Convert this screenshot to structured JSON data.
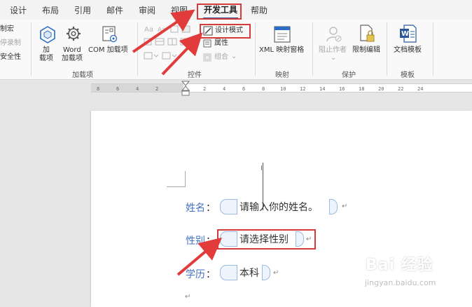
{
  "tabs": [
    {
      "label": "设计"
    },
    {
      "label": "布局"
    },
    {
      "label": "引用"
    },
    {
      "label": "邮件"
    },
    {
      "label": "审阅"
    },
    {
      "label": "视图"
    },
    {
      "label": "开发工具",
      "active": true
    },
    {
      "label": "帮助"
    }
  ],
  "ribbon": {
    "code": {
      "record_macro": "制宏",
      "pause_recording": "停录制",
      "macro_security": "安全性"
    },
    "addins": {
      "addin_line1": "加",
      "addin_line2": "载项",
      "word_addin_line1": "Word",
      "word_addin_line2": "加载项",
      "com_addin": "COM 加载项",
      "group_label": "加载项"
    },
    "controls": {
      "design_mode": "设计模式",
      "properties": "属性",
      "group_dropdown": "组合",
      "group_label": "控件"
    },
    "mapping": {
      "xml_pane": "XML 映射窗格",
      "group_label": "映射"
    },
    "protect": {
      "block_authors": "阻止作者",
      "restrict_editing": "限制编辑",
      "group_label": "保护"
    },
    "templates": {
      "doc_template": "文档模板",
      "group_label": "模板"
    }
  },
  "ruler": {
    "ticks": [
      "8",
      "6",
      "4",
      "2",
      "",
      "2",
      "4",
      "6",
      "8",
      "10",
      "12",
      "14",
      "16",
      "18",
      "20",
      "22",
      "24"
    ]
  },
  "document": {
    "fields": [
      {
        "label": "姓名",
        "colon": "：",
        "content": "请输入你的姓名。"
      },
      {
        "label": "性别",
        "colon": "：",
        "content": "请选择性别"
      },
      {
        "label": "学历",
        "colon": "：",
        "content": "本科"
      }
    ],
    "paragraph_mark": "↵"
  },
  "watermark": {
    "brand": "Bai 经验",
    "url": "jingyan.baidu.com"
  },
  "colors": {
    "accent": "#2b579a",
    "highlight": "#d63a3a",
    "field_label": "#4472c4"
  }
}
